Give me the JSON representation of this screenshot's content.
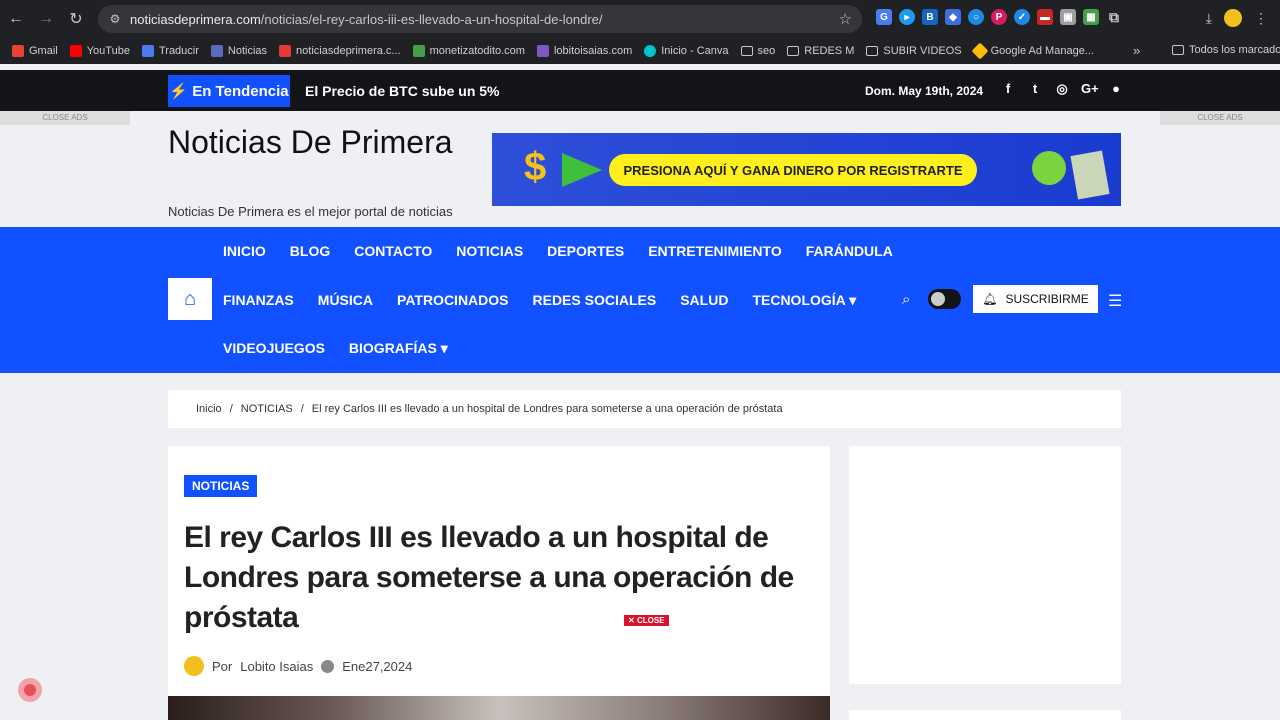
{
  "browser": {
    "url_domain": "noticiasdeprimera.com",
    "url_path": "/noticias/el-rey-carlos-iii-es-llevado-a-un-hospital-de-londre/",
    "bookmarks": [
      "Gmail",
      "YouTube",
      "Traducir",
      "Noticias",
      "noticiasdeprimera.c...",
      "monetizatodito.com",
      "lobitoisaias.com",
      "Inicio - Canva",
      "seo",
      "REDES M",
      "SUBIR VIDEOS",
      "Google Ad Manage..."
    ],
    "all_bookmarks": "Todos los marcadores"
  },
  "topbar": {
    "trending_label": "En Tendencia",
    "trending_text": "El Precio de BTC sube un 5%",
    "date": "Dom. May 19th, 2024",
    "social": [
      "facebook-icon",
      "twitter-icon",
      "instagram-icon",
      "google-plus-icon",
      "user-icon"
    ]
  },
  "header": {
    "close_ads": "CLOSE ADS",
    "site_title": "Noticias De Primera",
    "tagline": "Noticias De Primera es el mejor portal de noticias",
    "banner_text": "PRESIONA AQUÍ Y GANA DINERO  POR REGISTRARTE"
  },
  "nav": {
    "row1": [
      "INICIO",
      "BLOG",
      "CONTACTO",
      "NOTICIAS",
      "DEPORTES",
      "ENTRETENIMIENTO",
      "FARÁNDULA"
    ],
    "row2": [
      "FINANZAS",
      "MÚSICA",
      "PATROCINADOS",
      "REDES SOCIALES",
      "SALUD",
      "TECNOLOGÍA ▾"
    ],
    "row3": [
      "VIDEOJUEGOS",
      "BIOGRAFÍAS ▾"
    ],
    "subscribe": "SUSCRIBIRME"
  },
  "breadcrumb": [
    "Inicio",
    "NOTICIAS",
    "El rey Carlos III es llevado a un hospital de Londres para someterse a una operación de próstata"
  ],
  "article": {
    "category": "NOTICIAS",
    "title": "El rey Carlos III es llevado a un hospital de Londres para someterse a una operación de próstata",
    "close_label": "CLOSE",
    "by": "Por",
    "author": "Lobito Isaias",
    "date": "Ene27,2024"
  },
  "colors": {
    "brand": "#1151ff",
    "dark": "#121418"
  }
}
